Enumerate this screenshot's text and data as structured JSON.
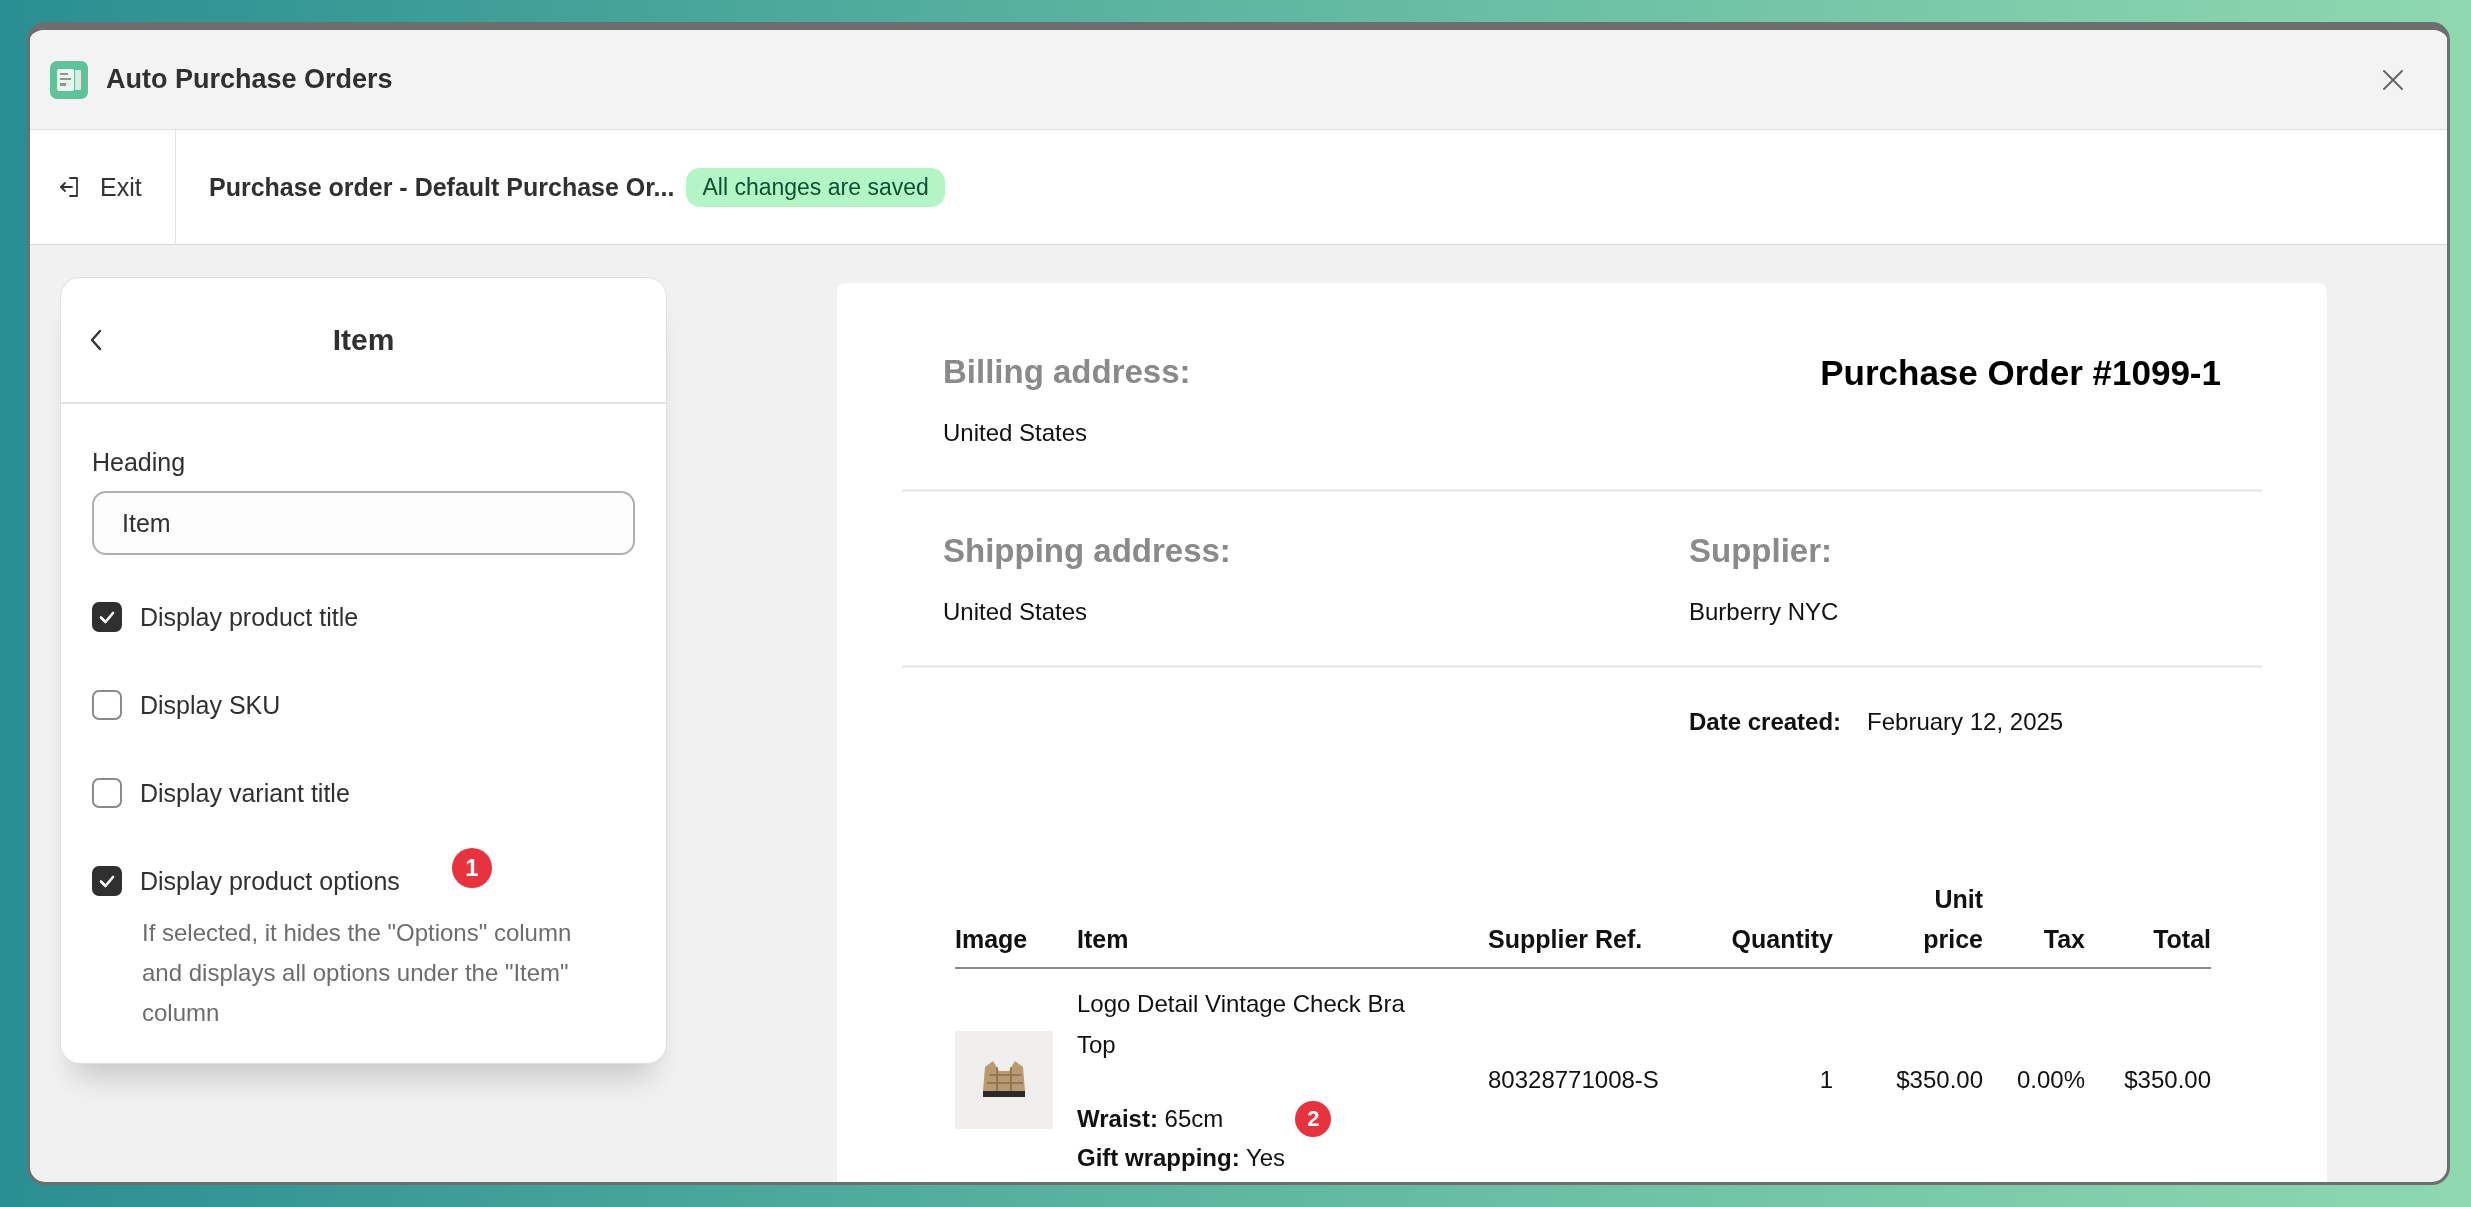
{
  "app": {
    "title": "Auto Purchase Orders"
  },
  "toolbar": {
    "exit": "Exit",
    "document_title": "Purchase order - Default Purchase Or...",
    "status_badge": "All changes are saved"
  },
  "panel": {
    "title": "Item",
    "heading_label": "Heading",
    "heading_value": "Item",
    "options": [
      {
        "label": "Display product title",
        "checked": true
      },
      {
        "label": "Display SKU",
        "checked": false
      },
      {
        "label": "Display variant title",
        "checked": false
      },
      {
        "label": "Display product options",
        "checked": true,
        "help": "If selected, it hides the \"Options\" column and displays all options under the \"Item\" column",
        "marker": "1"
      }
    ]
  },
  "document": {
    "title": "Purchase Order #1099-1",
    "billing": {
      "label": "Billing address:",
      "value": "United States"
    },
    "shipping": {
      "label": "Shipping address:",
      "value": "United States"
    },
    "supplier": {
      "label": "Supplier:",
      "value": "Burberry NYC"
    },
    "date": {
      "label": "Date created:",
      "value": "February 12, 2025"
    },
    "table": {
      "columns": [
        {
          "label": "Image"
        },
        {
          "label": "Item"
        },
        {
          "label": "Supplier Ref."
        },
        {
          "label": "Quantity"
        },
        {
          "label": "Unit price"
        },
        {
          "label": "Tax"
        },
        {
          "label": "Total"
        }
      ],
      "rows": [
        {
          "item": "Logo Detail Vintage Check Bra Top",
          "options": [
            {
              "name": "Wraist:",
              "value": "65cm",
              "marker": "2"
            },
            {
              "name": "Gift wrapping:",
              "value": "Yes"
            }
          ],
          "supplier_ref": "80328771008-S",
          "quantity": "1",
          "unit_price": "$350.00",
          "tax": "0.00%",
          "total": "$350.00"
        }
      ]
    }
  }
}
